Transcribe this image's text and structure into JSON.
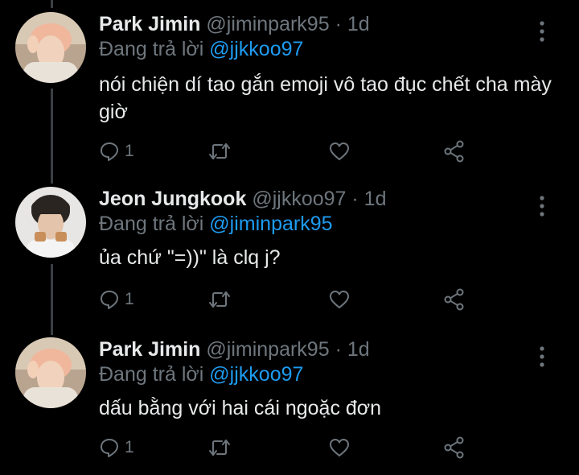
{
  "tweets": [
    {
      "display_name": "Park Jimin",
      "handle": "@jiminpark95",
      "separator": "·",
      "time": "1d",
      "replying_prefix": "Đang trả lời",
      "replying_to": "@jjkkoo97",
      "text": "nói chiện dí tao gắn emoji vô tao đục chết cha mày giờ",
      "reply_count": "1",
      "avatar_icon": "avatar-pink-hair"
    },
    {
      "display_name": "Jeon Jungkook",
      "handle": "@jjkkoo97",
      "separator": "·",
      "time": "1d",
      "replying_prefix": "Đang trả lời",
      "replying_to": "@jiminpark95",
      "text": "ủa chứ \"=))\" là clq j?",
      "reply_count": "1",
      "avatar_icon": "avatar-dark-hair"
    },
    {
      "display_name": "Park Jimin",
      "handle": "@jiminpark95",
      "separator": "·",
      "time": "1d",
      "replying_prefix": "Đang trả lời",
      "replying_to": "@jjkkoo97",
      "text": "dấu bằng với hai cái ngoặc đơn",
      "reply_count": "1",
      "avatar_icon": "avatar-pink-hair"
    }
  ],
  "icons": {
    "reply": "reply-icon",
    "retweet": "retweet-icon",
    "like": "heart-icon",
    "share": "share-icon",
    "more": "more-vertical-icon"
  },
  "colors": {
    "background": "#000000",
    "text": "#e7e9ea",
    "secondary": "#6e767d",
    "link": "#1d9bf0",
    "thread_line": "#3a3f44"
  }
}
